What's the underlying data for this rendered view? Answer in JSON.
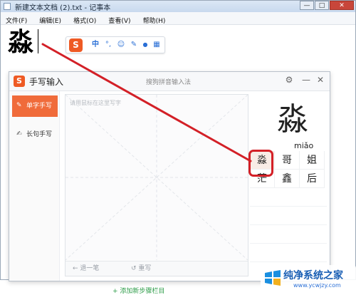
{
  "notepad": {
    "title": "新建文本文档 (2).txt - 记事本",
    "menu": [
      "文件(F)",
      "编辑(E)",
      "格式(O)",
      "查看(V)",
      "帮助(H)"
    ],
    "document_text": "淼",
    "window_buttons": {
      "minimize": "—",
      "maximize": "□",
      "close": "✕"
    }
  },
  "ime_toolbar": {
    "logo": "S",
    "mode_label": "中",
    "buttons": [
      {
        "icon": "punctuation-icon",
        "glyph": "°,"
      },
      {
        "icon": "emoji-icon",
        "glyph": "☺"
      },
      {
        "icon": "pen-icon",
        "glyph": "✎"
      },
      {
        "icon": "microphone-icon",
        "glyph": "●"
      },
      {
        "icon": "toolbox-icon",
        "glyph": "▦"
      }
    ]
  },
  "handwriting": {
    "title": "手写输入",
    "subtitle": "搜狗拼音输入法",
    "controls": {
      "settings": "⚙",
      "minimize": "—",
      "close": "✕"
    },
    "tabs": [
      {
        "label": "单字手写",
        "active": true
      },
      {
        "label": "长句手写",
        "active": false
      }
    ],
    "pad_placeholder": "请用鼠标在这里写字",
    "undo_label": "← 退一笔",
    "rewrite_label": "↺ 重写",
    "recognized": {
      "char": "淼",
      "pinyin": "miǎo"
    },
    "candidates": [
      "淼",
      "哥",
      "姐",
      "茫",
      "鑫",
      "后"
    ]
  },
  "footer": {
    "add_step": "+ 添加新步骤栏目"
  },
  "watermark": {
    "title": "纯净系统之家",
    "subtitle": "www.ycwjzy.com"
  },
  "colors": {
    "accent": "#f06b3a",
    "annotation_red": "#d32027",
    "sogou_orange": "#ee5a24"
  }
}
